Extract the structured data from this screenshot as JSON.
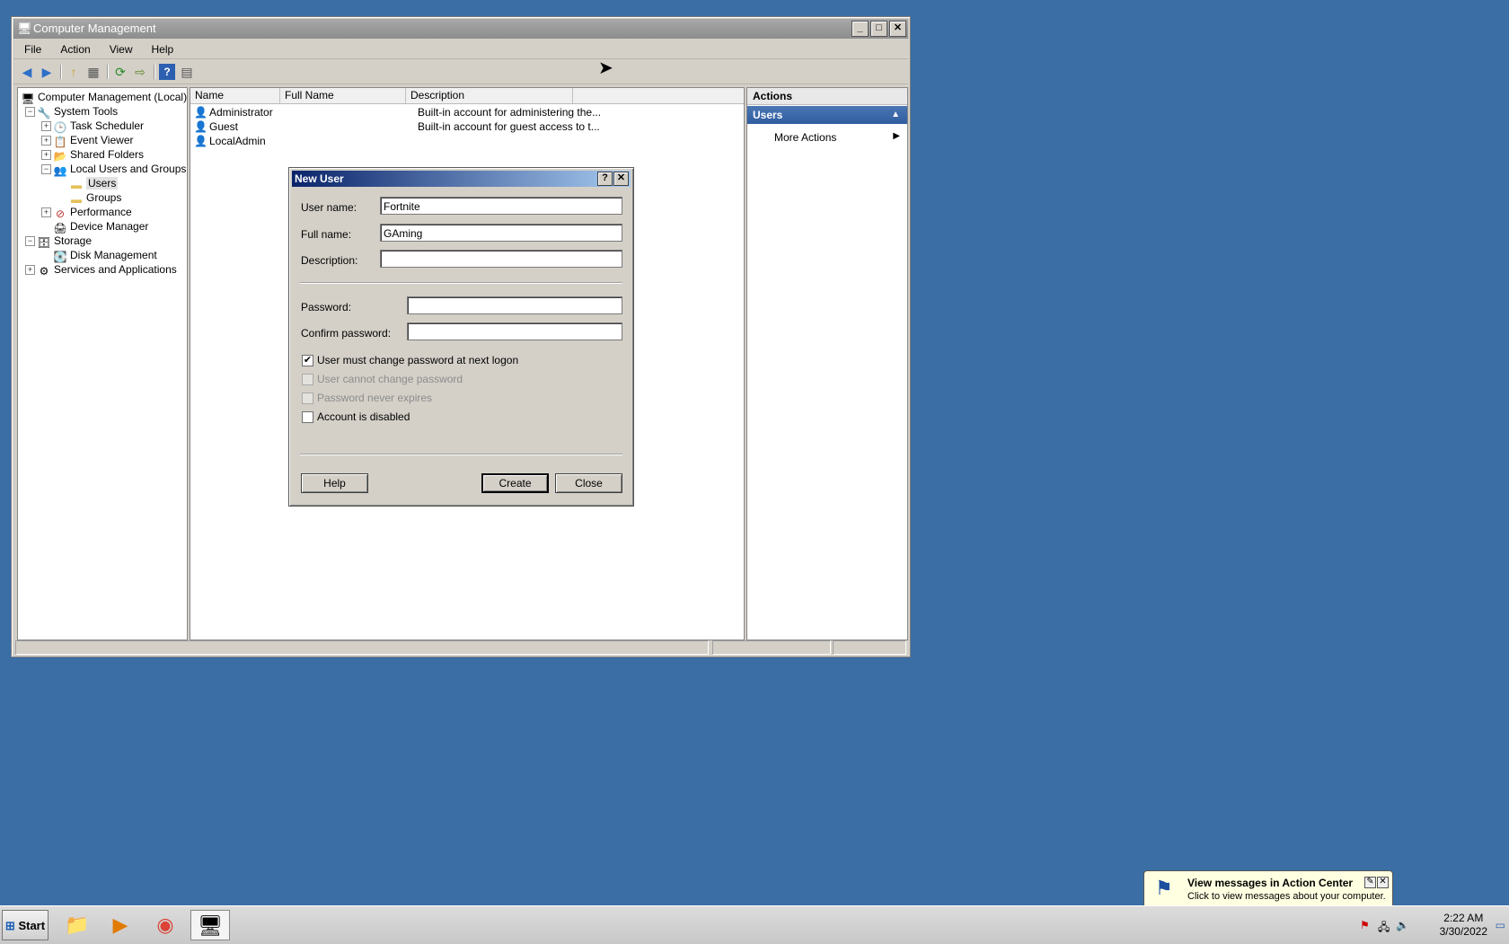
{
  "window": {
    "title": "Computer Management",
    "buttons": {
      "min": "_",
      "max": "□",
      "close": "✕"
    }
  },
  "menu": [
    "File",
    "Action",
    "View",
    "Help"
  ],
  "tree": {
    "root": "Computer Management (Local)",
    "system_tools": "System Tools",
    "task_scheduler": "Task Scheduler",
    "event_viewer": "Event Viewer",
    "shared_folders": "Shared Folders",
    "local_users_groups": "Local Users and Groups",
    "users": "Users",
    "groups": "Groups",
    "performance": "Performance",
    "device_manager": "Device Manager",
    "storage": "Storage",
    "disk_management": "Disk Management",
    "services": "Services and Applications"
  },
  "list": {
    "headers": [
      "Name",
      "Full Name",
      "Description"
    ],
    "rows": [
      {
        "name": "Administrator",
        "full": "",
        "desc": "Built-in account for administering the..."
      },
      {
        "name": "Guest",
        "full": "",
        "desc": "Built-in account for guest access to t..."
      },
      {
        "name": "LocalAdmin",
        "full": "",
        "desc": ""
      }
    ]
  },
  "actions": {
    "header": "Actions",
    "section": "Users",
    "more": "More Actions"
  },
  "dialog": {
    "title": "New User",
    "help_btn": "?",
    "close_btn": "✕",
    "username_label": "User name:",
    "username": "Fortnite",
    "fullname_label": "Full name:",
    "fullname": "GAming",
    "description_label": "Description:",
    "description": "",
    "password_label": "Password:",
    "confirm_label": "Confirm password:",
    "checks": {
      "must_change": {
        "label": "User must change password at next logon",
        "checked": true,
        "enabled": true
      },
      "cannot_change": {
        "label": "User cannot change password",
        "checked": false,
        "enabled": false
      },
      "never_expires": {
        "label": "Password never expires",
        "checked": false,
        "enabled": false
      },
      "disabled": {
        "label": "Account is disabled",
        "checked": false,
        "enabled": true
      }
    },
    "help": "Help",
    "create": "Create",
    "close": "Close"
  },
  "taskbar": {
    "start": "Start",
    "time": "2:22 AM",
    "date": "3/30/2022"
  },
  "balloon": {
    "title": "View messages in Action Center",
    "text": "Click to view messages about your computer."
  }
}
